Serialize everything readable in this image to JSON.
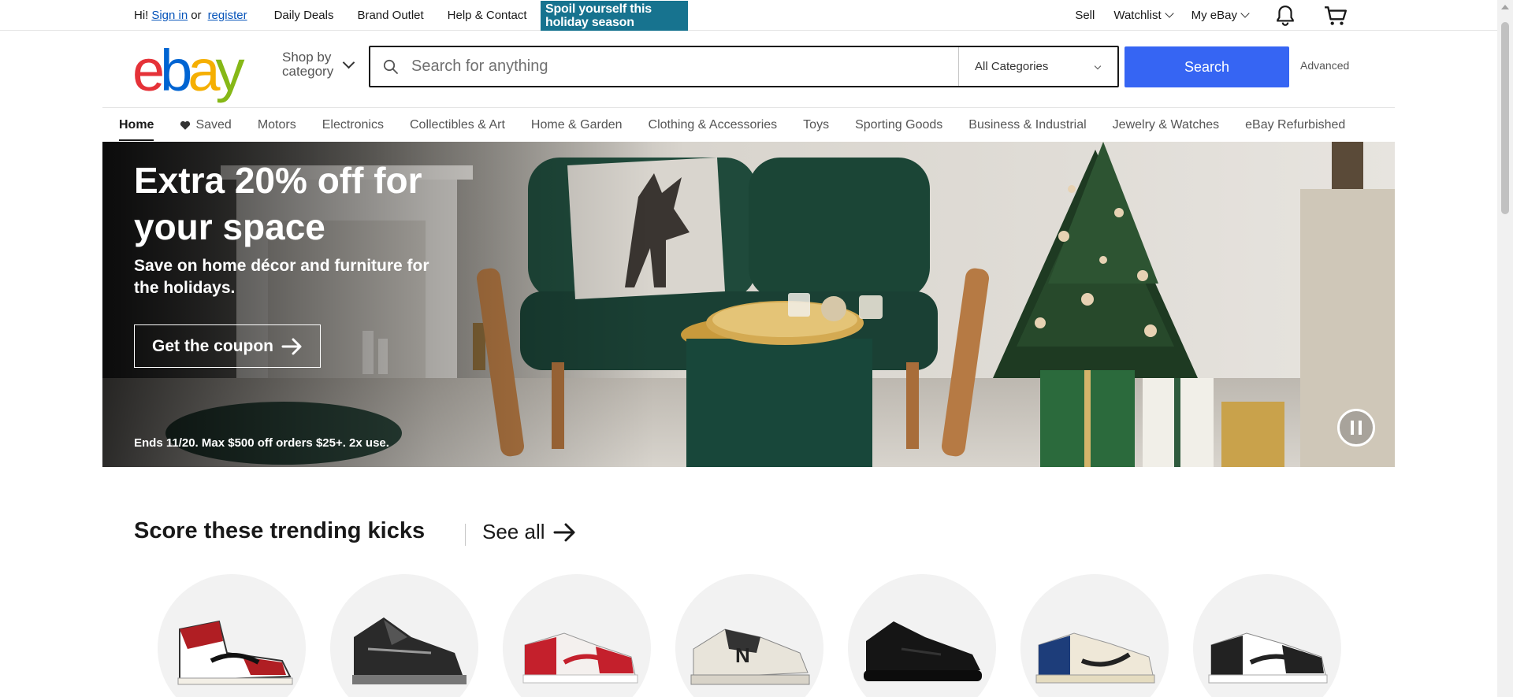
{
  "topbar": {
    "greeting": "Hi!",
    "sign_in": "Sign in",
    "or": "or",
    "register": "register",
    "links": [
      "Daily Deals",
      "Brand Outlet",
      "Help & Contact"
    ],
    "promo_text": "Spoil yourself this holiday season",
    "sell": "Sell",
    "watchlist": "Watchlist",
    "my_ebay": "My eBay",
    "icons": [
      "bell-icon",
      "cart-icon"
    ]
  },
  "header": {
    "logo": {
      "e": "e",
      "b": "b",
      "a": "a",
      "y": "y"
    },
    "shop_by_category": [
      "Shop by",
      "category"
    ],
    "search_placeholder": "Search for anything",
    "category_select": "All Categories",
    "search_button": "Search",
    "advanced": "Advanced"
  },
  "nav": {
    "items": [
      "Home",
      "Saved",
      "Motors",
      "Electronics",
      "Collectibles & Art",
      "Home & Garden",
      "Clothing & Accessories",
      "Toys",
      "Sporting Goods",
      "Business & Industrial",
      "Jewelry & Watches",
      "eBay Refurbished"
    ],
    "active": "Home"
  },
  "banner": {
    "title": "Extra 20% off for your space",
    "subtitle": "Save on home décor and furniture for the holidays.",
    "cta": "Get the coupon",
    "fine_print": "Ends 11/20. Max $500 off orders $25+. 2x use."
  },
  "trending": {
    "title": "Score these trending kicks",
    "see_all": "See all",
    "items": [
      {
        "name": "sneaker-red-white-high",
        "color": "#b01e23"
      },
      {
        "name": "sneaker-black-gray",
        "color": "#2a2a2a"
      },
      {
        "name": "sneaker-red-white-low",
        "color": "#c4202c"
      },
      {
        "name": "sneaker-cream-new-balance",
        "color": "#e8e4da"
      },
      {
        "name": "sneaker-all-black",
        "color": "#151515"
      },
      {
        "name": "sneaker-blue-cream",
        "color": "#1d3d7a"
      },
      {
        "name": "sneaker-black-white-panda",
        "color": "#222222"
      }
    ]
  },
  "colors": {
    "search_blue": "#3665f3",
    "link_blue": "#0654ba",
    "promo_teal": "#17738f"
  }
}
